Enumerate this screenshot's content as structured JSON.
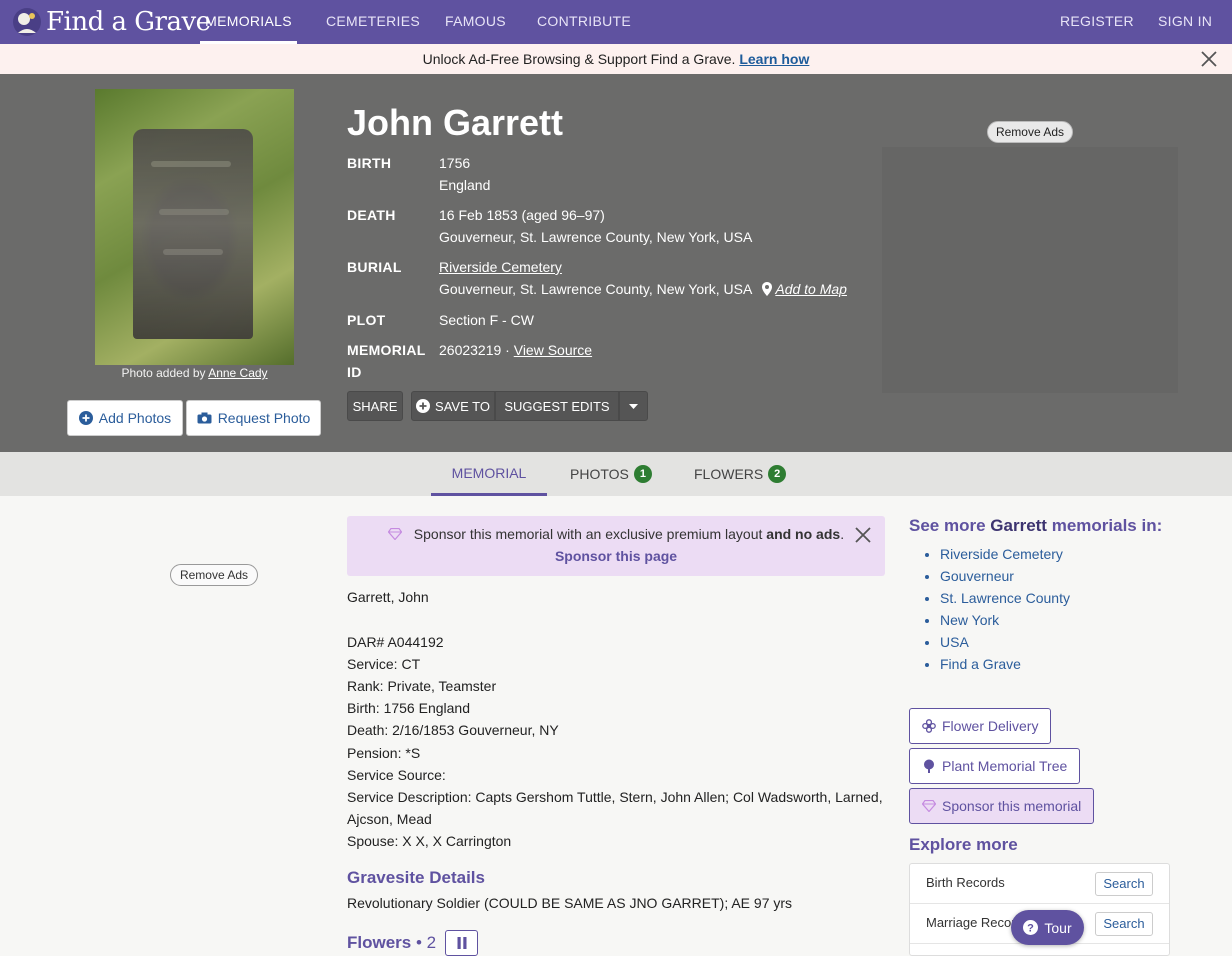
{
  "nav": {
    "logo_text": "Find a Grave",
    "items": [
      "MEMORIALS",
      "CEMETERIES",
      "FAMOUS",
      "CONTRIBUTE"
    ],
    "register": "REGISTER",
    "sign_in": "SIGN IN"
  },
  "promo": {
    "text": "Unlock Ad-Free Browsing & Support Find a Grave.",
    "link": "Learn how"
  },
  "hero": {
    "photo_credit_prefix": "Photo added by",
    "photo_credit_name": "Anne Cady",
    "add_photos": "Add Photos",
    "request_photo": "Request Photo",
    "name": "John Garrett",
    "birth_label": "BIRTH",
    "birth_date": "1756",
    "birth_place": "England",
    "death_label": "DEATH",
    "death_date": "16 Feb 1853 (aged 96–97)",
    "death_place": "Gouverneur, St. Lawrence County, New York, USA",
    "burial_label": "BURIAL",
    "burial_cemetery": "Riverside Cemetery",
    "burial_place": "Gouverneur, St. Lawrence County, New York, USA",
    "add_to_map": "Add to Map",
    "plot_label": "PLOT",
    "plot_value": "Section F - CW",
    "memorial_label_1": "MEMORIAL",
    "memorial_label_2": "ID",
    "memorial_id": "26023219 ·",
    "view_source": "View Source",
    "share": "SHARE",
    "save_to": "SAVE TO",
    "suggest_edits": "SUGGEST EDITS",
    "remove_ads": "Remove Ads"
  },
  "tabs": {
    "memorial": "MEMORIAL",
    "photos": "PHOTOS",
    "photos_count": "1",
    "flowers": "FLOWERS",
    "flowers_count": "2"
  },
  "content": {
    "remove_ads": "Remove Ads",
    "sponsor_text": "Sponsor this memorial with an exclusive premium layout",
    "sponsor_bold": "and no ads",
    "sponsor_link": "Sponsor this page",
    "bio": [
      "Garrett, John",
      "DAR# A044192",
      "Service: CT",
      "Rank: Private, Teamster",
      "Birth: 1756 England",
      "Death: 2/16/1853 Gouverneur, NY",
      "Pension: *S",
      "Service Source:",
      "Service Description: Capts Gershom Tuttle, Stern, John Allen; Col Wadsworth, Larned,",
      "Ajcson, Mead",
      "Spouse: X X, X Carrington"
    ],
    "gravesite_title": "Gravesite Details",
    "gravesite_text": "Revolutionary Soldier (COULD BE SAME AS JNO GARRET); AE 97 yrs",
    "flowers_title": "Flowers",
    "flowers_count": "• 2"
  },
  "sidebar": {
    "see_more_prefix": "See more",
    "see_more_name": "Garrett",
    "see_more_suffix": "memorials in:",
    "links": [
      "Riverside Cemetery",
      "Gouverneur",
      "St. Lawrence County",
      "New York",
      "USA",
      "Find a Grave"
    ],
    "flower_delivery": "Flower Delivery",
    "plant_tree": "Plant Memorial Tree",
    "sponsor_memorial": "Sponsor this memorial",
    "explore_title": "Explore more",
    "explore_rows": [
      {
        "label": "Birth Records",
        "button": "Search"
      },
      {
        "label": "Marriage Records",
        "button": "Search"
      }
    ],
    "tour": "Tour"
  },
  "colors": {
    "brand_purple": "#5f52a0",
    "hero_gray": "#6b6b6a",
    "badge_green": "#2e7d32",
    "link_blue": "#2b5d9b"
  }
}
